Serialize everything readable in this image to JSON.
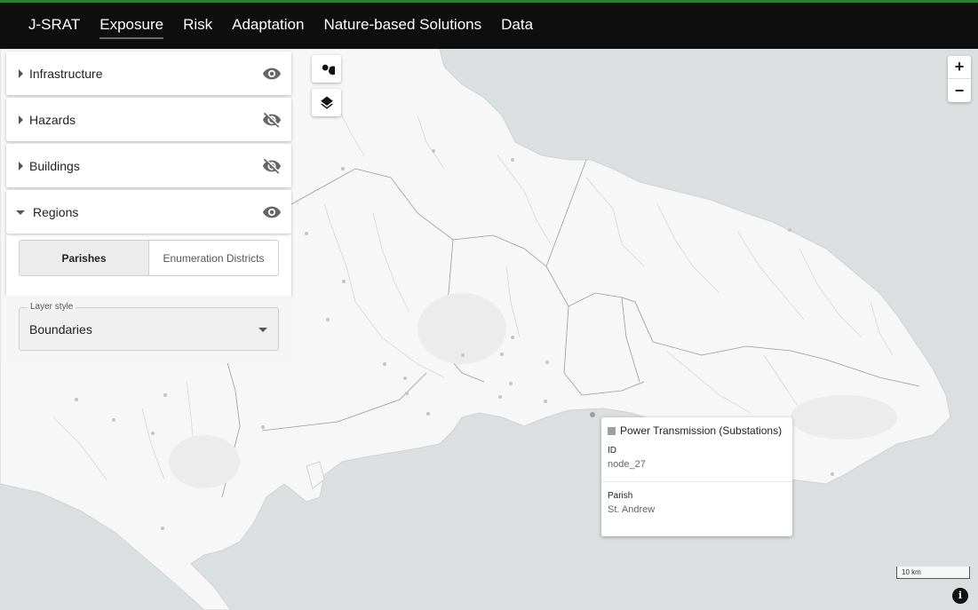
{
  "nav": {
    "brand": "J-SRAT",
    "items": [
      "Exposure",
      "Risk",
      "Adaptation",
      "Nature-based Solutions",
      "Data"
    ],
    "active": "Exposure"
  },
  "sidebar": {
    "panels": [
      {
        "label": "Infrastructure",
        "icon": "eye-icon"
      },
      {
        "label": "Hazards",
        "icon": "eye-off-icon"
      },
      {
        "label": "Buildings",
        "icon": "eye-off-icon"
      },
      {
        "label": "Regions",
        "icon": "eye-icon"
      }
    ],
    "regions": {
      "toggle": [
        "Parishes",
        "Enumeration Districts"
      ],
      "selected": "Parishes",
      "layer_style_label": "Layer style",
      "layer_style_value": "Boundaries"
    }
  },
  "map": {
    "search_icon": "search-icon",
    "layers_icon": "layers-icon",
    "zoom_in": "+",
    "zoom_out": "−",
    "scale": "10 km",
    "info": "i"
  },
  "tooltip": {
    "title": "Power Transmission (Substations)",
    "fields": [
      {
        "key": "ID",
        "value": "node_27"
      },
      {
        "key": "Parish",
        "value": "St. Andrew"
      }
    ]
  }
}
